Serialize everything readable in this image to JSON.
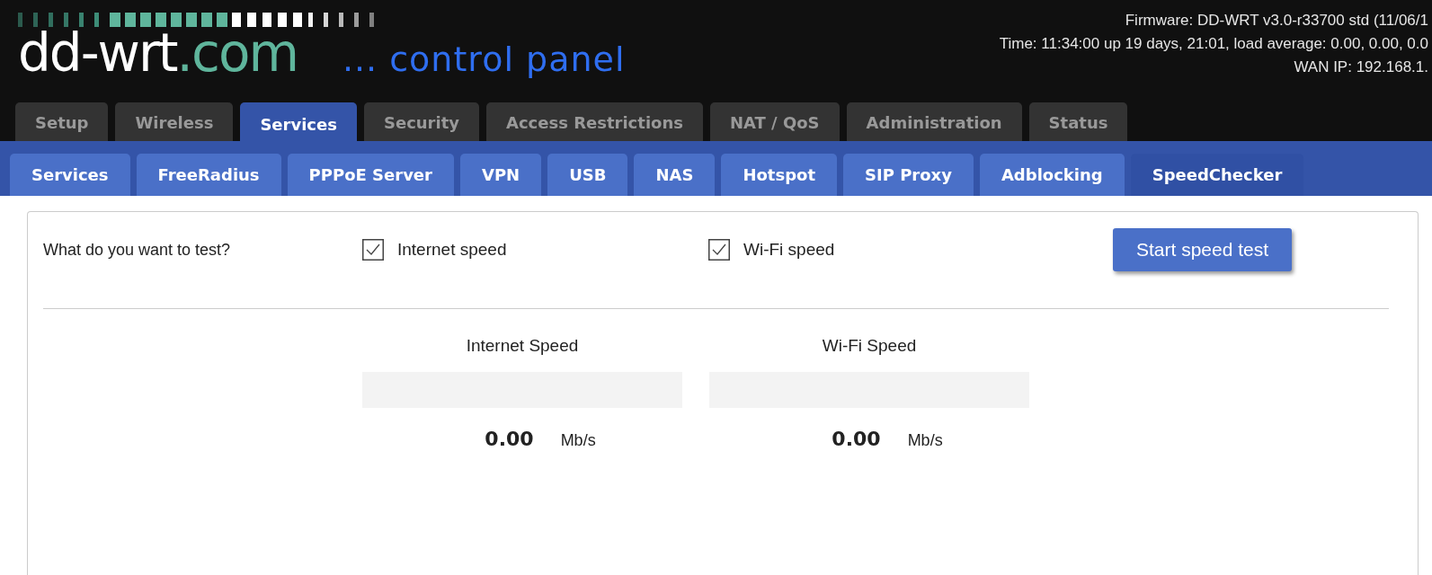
{
  "header": {
    "logo": {
      "name": "dd-wrt",
      "suffix": ".com"
    },
    "tagline": "... control panel",
    "info": [
      "Firmware: DD-WRT v3.0-r33700 std (11/06/1",
      "Time: 11:34:00 up 19 days, 21:01, load average: 0.00, 0.00, 0.0",
      "WAN IP: 192.168.1."
    ]
  },
  "tabs": [
    {
      "label": "Setup",
      "selected": false
    },
    {
      "label": "Wireless",
      "selected": false
    },
    {
      "label": "Services",
      "selected": true
    },
    {
      "label": "Security",
      "selected": false
    },
    {
      "label": "Access Restrictions",
      "selected": false
    },
    {
      "label": "NAT / QoS",
      "selected": false
    },
    {
      "label": "Administration",
      "selected": false
    },
    {
      "label": "Status",
      "selected": false
    }
  ],
  "subtabs": [
    {
      "label": "Services",
      "selected": false
    },
    {
      "label": "FreeRadius",
      "selected": false
    },
    {
      "label": "PPPoE Server",
      "selected": false
    },
    {
      "label": "VPN",
      "selected": false
    },
    {
      "label": "USB",
      "selected": false
    },
    {
      "label": "NAS",
      "selected": false
    },
    {
      "label": "Hotspot",
      "selected": false
    },
    {
      "label": "SIP Proxy",
      "selected": false
    },
    {
      "label": "Adblocking",
      "selected": false
    },
    {
      "label": "SpeedChecker",
      "selected": true
    }
  ],
  "test": {
    "question": "What do you want to test?",
    "options": [
      {
        "label": "Internet speed",
        "checked": true
      },
      {
        "label": "Wi-Fi speed",
        "checked": true
      }
    ],
    "button": "Start speed test"
  },
  "meters": [
    {
      "title": "Internet Speed",
      "value": "0.00",
      "unit": "Mb/s"
    },
    {
      "title": "Wi-Fi Speed",
      "value": "0.00",
      "unit": "Mb/s"
    }
  ]
}
